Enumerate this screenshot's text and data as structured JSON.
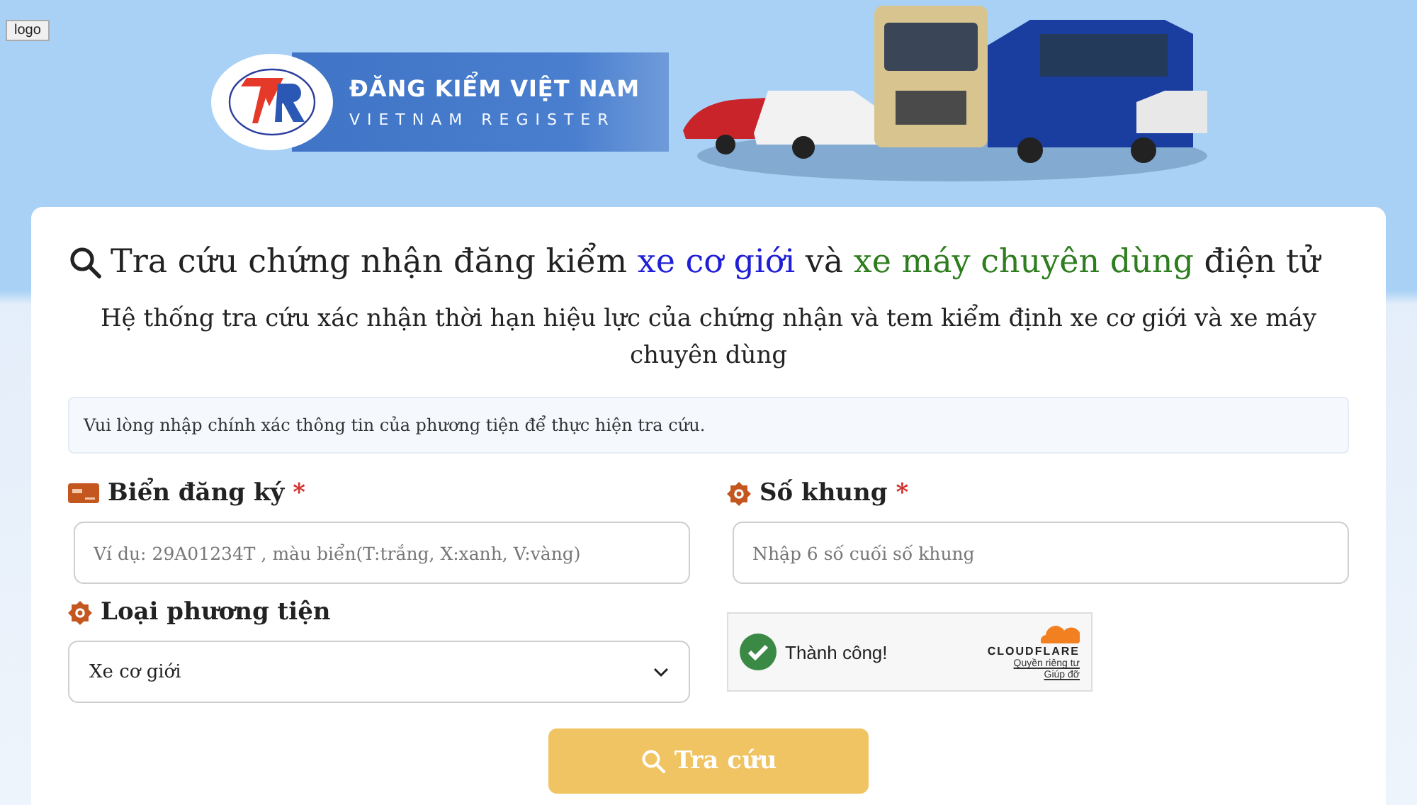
{
  "logo_tooltip": "logo",
  "banner": {
    "title": "ĐĂNG KIỂM VIỆT NAM",
    "subtitle": "VIETNAM REGISTER"
  },
  "heading": [
    {
      "text": "Tra cứu chứng nhận đăng kiểm ",
      "color": "#222222"
    },
    {
      "text": "xe cơ giới",
      "color": "#1f1fd6"
    },
    {
      "text": " và ",
      "color": "#222222"
    },
    {
      "text": "xe máy chuyên dùng",
      "color": "#2e7d1e"
    },
    {
      "text": " điện tử",
      "color": "#222222"
    }
  ],
  "description": "Hệ thống tra cứu xác nhận thời hạn hiệu lực của chứng nhận và tem kiểm định xe cơ giới và xe máy chuyên dùng",
  "notice": "Vui lòng nhập chính xác thông tin của phương tiện để thực hiện tra cứu.",
  "fields": [
    {
      "kind": "input",
      "label": "Biển đăng ký",
      "required_mark": "*",
      "placeholder": "Ví dụ: 29A01234T , màu biển(T:trắng, X:xanh, V:vàng)"
    },
    {
      "kind": "input",
      "label": "Số khung",
      "required_mark": "*",
      "placeholder": "Nhập 6 số cuối số khung"
    },
    {
      "kind": "select",
      "label": "Loại phương tiện",
      "value": "Xe cơ giới"
    },
    {
      "kind": "captcha",
      "status": "Thành công!",
      "brand": "CLOUDFLARE",
      "links": [
        "Quyền riêng tư",
        "Giúp đỡ"
      ]
    }
  ],
  "submit_button": "Tra cứu"
}
